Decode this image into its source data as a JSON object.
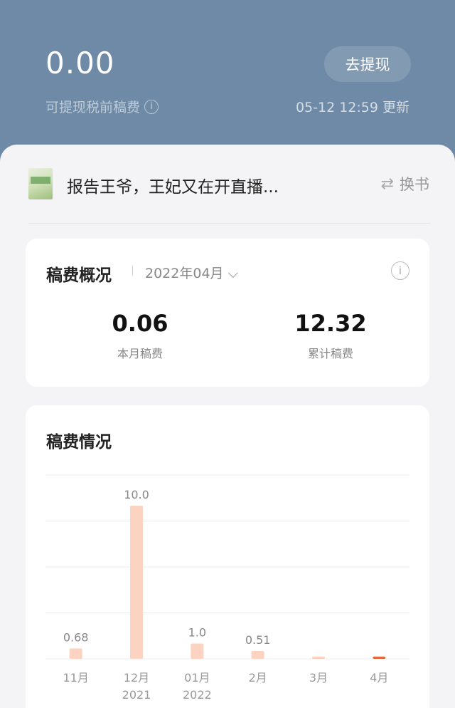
{
  "header": {
    "balance": "0.00",
    "withdraw_label": "去提现",
    "balance_label": "可提现税前稿费",
    "info_glyph": "i",
    "updated": "05-12 12:59 更新"
  },
  "book": {
    "title": "报告王爷，王妃又在开直播...",
    "switch_label": "换书",
    "switch_icon": "swap-icon"
  },
  "overview": {
    "title": "稿费概况",
    "month": "2022年04月",
    "info_glyph": "i",
    "this_month_value": "0.06",
    "this_month_label": "本月稿费",
    "total_value": "12.32",
    "total_label": "累计稿费"
  },
  "chart_section": {
    "title": "稿费情况"
  },
  "chart_data": {
    "type": "bar",
    "title": "稿费情况",
    "categories": [
      "11月",
      "12月",
      "01月",
      "2月",
      "3月",
      "4月"
    ],
    "sub_labels": [
      "",
      "2021",
      "2022",
      "",
      "",
      ""
    ],
    "values": [
      0.68,
      10.0,
      1.0,
      0.51,
      0.15,
      0.15
    ],
    "data_labels": [
      "0.68",
      "10.0",
      "1.0",
      "0.51",
      "",
      ""
    ],
    "ylim": [
      0,
      12
    ],
    "grid": true,
    "colors": {
      "bar": "#fcd3c0",
      "highlight": "#e46a3a",
      "grid": "#ececec"
    }
  }
}
